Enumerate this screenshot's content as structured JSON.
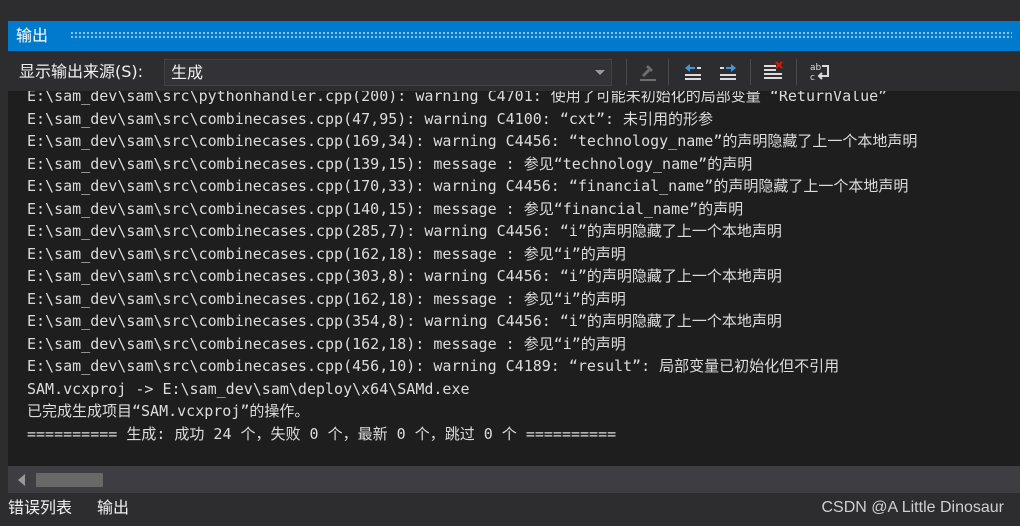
{
  "window": {
    "title": "输出"
  },
  "toolbar": {
    "source_label": "显示输出来源(S):",
    "source_value": "生成",
    "icons": [
      "find-message-icon",
      "previous-message-icon",
      "next-message-icon",
      "clear-all-icon",
      "word-wrap-icon"
    ]
  },
  "output": {
    "lines": [
      "E:\\sam_dev\\sam\\src\\pythonhandler.cpp(200): warning C4701: 使用了可能未初始化的局部变量 “ReturnValue”",
      "E:\\sam_dev\\sam\\src\\combinecases.cpp(47,95): warning C4100: “cxt”: 未引用的形参",
      "E:\\sam_dev\\sam\\src\\combinecases.cpp(169,34): warning C4456: “technology_name”的声明隐藏了上一个本地声明",
      "E:\\sam_dev\\sam\\src\\combinecases.cpp(139,15): message : 参见“technology_name”的声明",
      "E:\\sam_dev\\sam\\src\\combinecases.cpp(170,33): warning C4456: “financial_name”的声明隐藏了上一个本地声明",
      "E:\\sam_dev\\sam\\src\\combinecases.cpp(140,15): message : 参见“financial_name”的声明",
      "E:\\sam_dev\\sam\\src\\combinecases.cpp(285,7): warning C4456: “i”的声明隐藏了上一个本地声明",
      "E:\\sam_dev\\sam\\src\\combinecases.cpp(162,18): message : 参见“i”的声明",
      "E:\\sam_dev\\sam\\src\\combinecases.cpp(303,8): warning C4456: “i”的声明隐藏了上一个本地声明",
      "E:\\sam_dev\\sam\\src\\combinecases.cpp(162,18): message : 参见“i”的声明",
      "E:\\sam_dev\\sam\\src\\combinecases.cpp(354,8): warning C4456: “i”的声明隐藏了上一个本地声明",
      "E:\\sam_dev\\sam\\src\\combinecases.cpp(162,18): message : 参见“i”的声明",
      "E:\\sam_dev\\sam\\src\\combinecases.cpp(456,10): warning C4189: “result”: 局部变量已初始化但不引用",
      "SAM.vcxproj -> E:\\sam_dev\\sam\\deploy\\x64\\SAMd.exe",
      "已完成生成项目“SAM.vcxproj”的操作。",
      "========== 生成: 成功 24 个，失败 0 个，最新 0 个，跳过 0 个 =========="
    ]
  },
  "tabs": [
    {
      "label": "错误列表"
    },
    {
      "label": "输出"
    }
  ],
  "watermark": "CSDN @A Little Dinosaur",
  "colors": {
    "title_bar": "#007acc",
    "background": "#2d2d30",
    "editor": "#1e1e1e",
    "text": "#dcdcdc"
  }
}
